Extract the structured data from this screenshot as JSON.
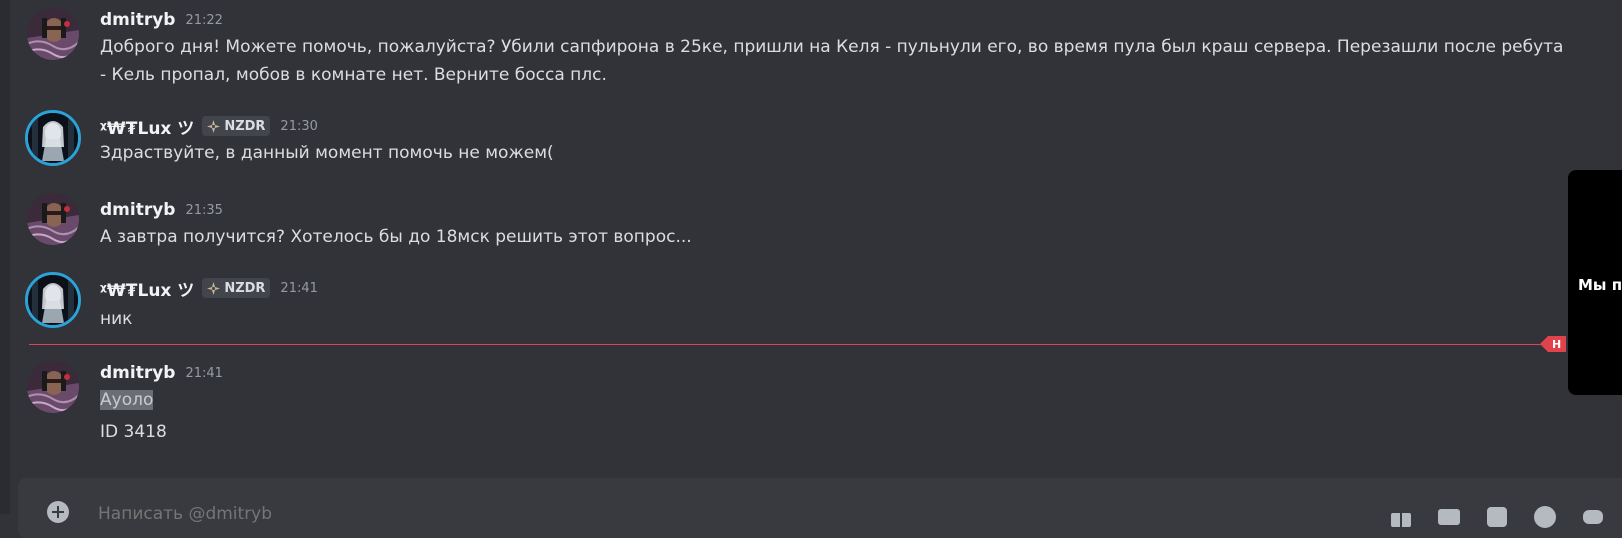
{
  "messages": [
    {
      "username": "dmitryb",
      "time": "21:22",
      "text": "Доброго дня! Можете помочь, пожалуйста? Убили сапфирона в 25ке, пришли на Келя - пульнули его, во время пула был краш сервера. Перезашли после ребута - Кель пропал, мобов в комнате нет. Верните босса плс."
    },
    {
      "username": "ᵡ₩₮Lux ツ",
      "tag": "NZDR",
      "time": "21:30",
      "text": "Здраствуйте, в данный момент помочь не можем("
    },
    {
      "username": "dmitryb",
      "time": "21:35",
      "text": "А завтра получится? Хотелось бы до 18мск решить этот вопрос..."
    },
    {
      "username": "ᵡ₩₮Lux ツ",
      "tag": "NZDR",
      "time": "21:41",
      "text": "ник"
    },
    {
      "username": "dmitryb",
      "time": "21:41",
      "text_highlighted": "Ауоло",
      "text_line2": "ID 3418"
    }
  ],
  "new_divider": {
    "label": "Н",
    "color": "#e0434b"
  },
  "popup": {
    "text": "Мы пр"
  },
  "composer": {
    "placeholder": "Написать @dmitryb",
    "icons": [
      "gift-icon",
      "gif-icon",
      "sticker-icon",
      "emoji-icon",
      "apps-icon"
    ]
  },
  "colors": {
    "background": "#323339",
    "text": "#dbdee1",
    "username": "#f2f3f5",
    "timestamp": "#949ba4",
    "avatar_ring": "#2ba3d9"
  }
}
